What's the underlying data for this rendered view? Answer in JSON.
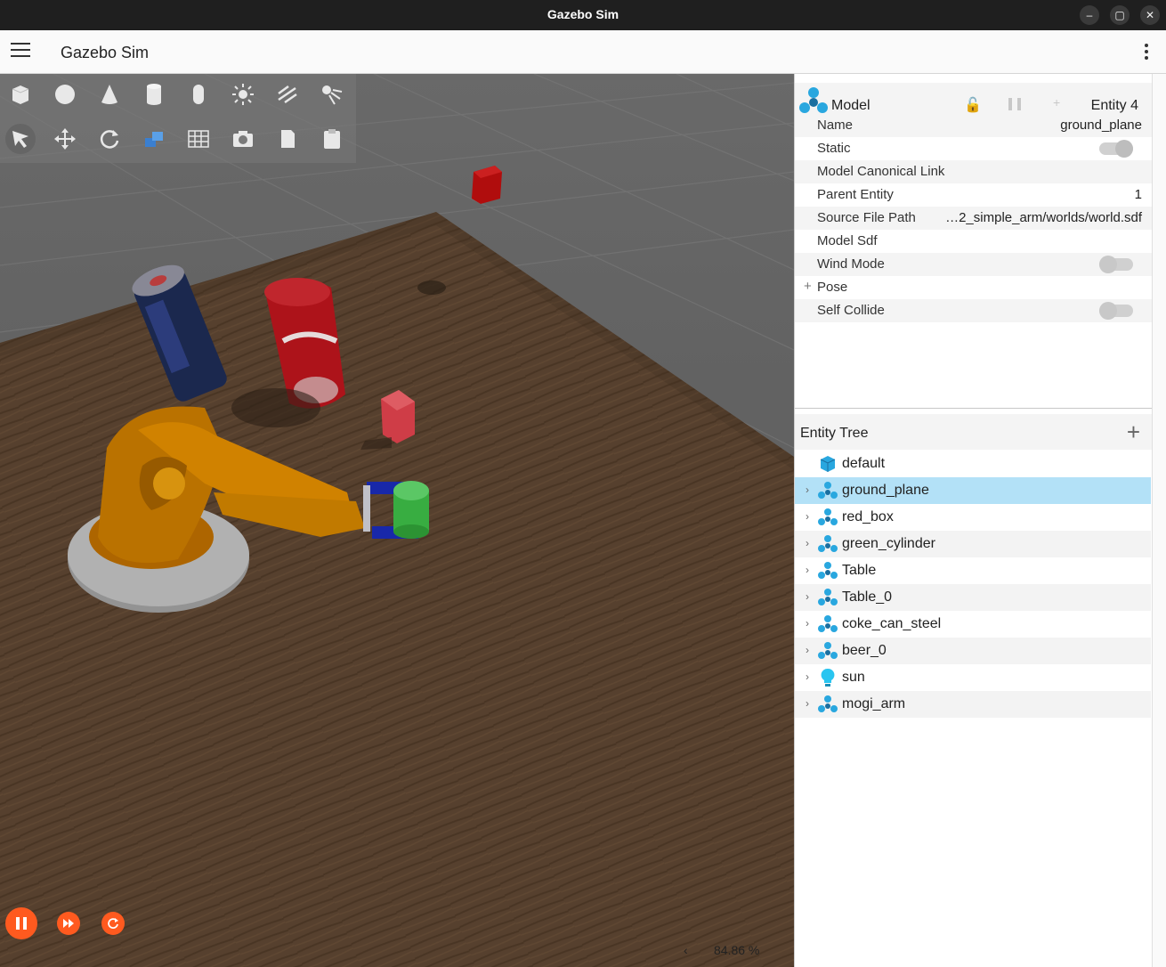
{
  "window": {
    "title": "Gazebo Sim"
  },
  "appbar": {
    "title": "Gazebo Sim"
  },
  "component_inspector": {
    "header_label": "Model",
    "entity_label": "Entity 4",
    "properties": [
      {
        "key": "Name",
        "value": "ground_plane"
      },
      {
        "key": "Static",
        "toggle": "on"
      },
      {
        "key": "Model Canonical Link",
        "value": ""
      },
      {
        "key": "Parent Entity",
        "value": "1"
      },
      {
        "key": "Source File Path",
        "value": "…2_simple_arm/worlds/world.sdf"
      },
      {
        "key": "Model Sdf",
        "value": ""
      },
      {
        "key": "Wind Mode",
        "toggle": "off"
      },
      {
        "key": "Pose",
        "expand": "+"
      },
      {
        "key": "Self Collide",
        "toggle": "off"
      }
    ]
  },
  "entity_tree": {
    "title": "Entity Tree",
    "add_label": "+",
    "items": [
      {
        "name": "default",
        "icon": "world-icon",
        "expandable": false
      },
      {
        "name": "ground_plane",
        "icon": "model-icon",
        "expandable": true,
        "selected": true
      },
      {
        "name": "red_box",
        "icon": "model-icon",
        "expandable": true
      },
      {
        "name": "green_cylinder",
        "icon": "model-icon",
        "expandable": true
      },
      {
        "name": "Table",
        "icon": "model-icon",
        "expandable": true
      },
      {
        "name": "Table_0",
        "icon": "model-icon",
        "expandable": true
      },
      {
        "name": "coke_can_steel",
        "icon": "model-icon",
        "expandable": true
      },
      {
        "name": "beer_0",
        "icon": "model-icon",
        "expandable": true
      },
      {
        "name": "sun",
        "icon": "light-icon",
        "expandable": true
      },
      {
        "name": "mogi_arm",
        "icon": "model-icon",
        "expandable": true
      }
    ]
  },
  "playback": {
    "zoom_label": "84.86 %",
    "arrow": "‹"
  },
  "colors": {
    "accent": "#ff5a1f",
    "selection": "#b3e1f7",
    "model_icon": "#29a7df"
  }
}
